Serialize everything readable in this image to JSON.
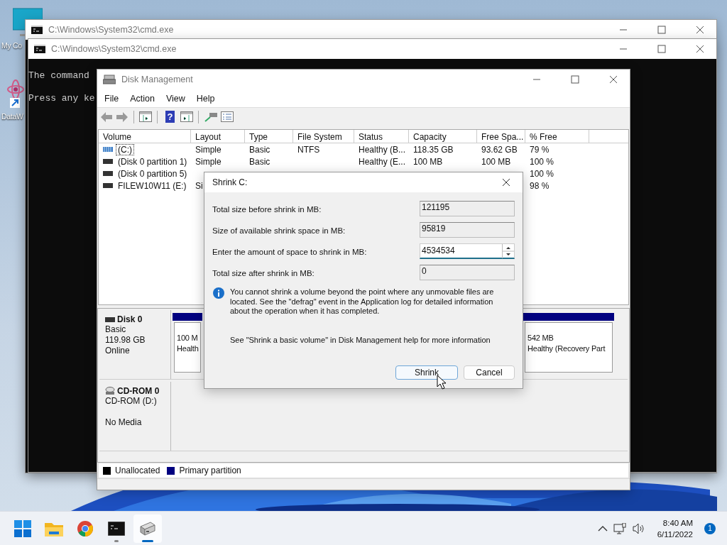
{
  "desktop_icons": [
    {
      "label": "My Co",
      "kind": "computer"
    },
    {
      "label": "DataW",
      "kind": "shortcut"
    }
  ],
  "console_windows": [
    {
      "title": "C:\\Windows\\System32\\cmd.exe"
    },
    {
      "title": "C:\\Windows\\System32\\cmd.exe",
      "lines": [
        "The command",
        "Press any ke"
      ]
    }
  ],
  "disk_management": {
    "title": "Disk Management",
    "menu": [
      "File",
      "Action",
      "View",
      "Help"
    ],
    "toolbar": [
      [
        {
          "kind": "back"
        },
        {
          "kind": "forward"
        }
      ],
      [
        {
          "kind": "console"
        }
      ],
      [
        {
          "kind": "help",
          "glyph": "?"
        },
        {
          "kind": "panel"
        }
      ],
      [
        {
          "kind": "connect"
        },
        {
          "kind": "list"
        }
      ]
    ],
    "columns": [
      "Volume",
      "Layout",
      "Type",
      "File System",
      "Status",
      "Capacity",
      "Free Spa...",
      "% Free"
    ],
    "rows": [
      {
        "selected": true,
        "cells": [
          "(C:)",
          "Simple",
          "Basic",
          "NTFS",
          "Healthy (B...",
          "118.35 GB",
          "93.62 GB",
          "79 %"
        ]
      },
      {
        "selected": false,
        "cells": [
          "(Disk 0 partition 1)",
          "Simple",
          "Basic",
          null,
          "Healthy (E...",
          "100 MB",
          "100 MB",
          "100 %"
        ]
      },
      {
        "selected": false,
        "cells": [
          "(Disk 0 partition 5)",
          null,
          null,
          null,
          null,
          null,
          null,
          "100 %"
        ]
      },
      {
        "selected": false,
        "cells": [
          "FILEW10W11 (E:)",
          "Si",
          null,
          null,
          null,
          null,
          null,
          "98 %"
        ]
      }
    ],
    "disks": [
      {
        "kind": "disk",
        "name": "Disk 0",
        "type": "Basic",
        "size": "119.98 GB",
        "status": "Online",
        "partitions": [
          {
            "lines": [
              "100 M",
              "Health"
            ]
          },
          {
            "lines": [
              "542 MB",
              "Healthy (Recovery Part"
            ]
          }
        ]
      },
      {
        "kind": "cdrom",
        "name": "CD-ROM 0",
        "type": "CD-ROM (D:)",
        "status": "No Media"
      }
    ],
    "legend": [
      {
        "label": "Unallocated",
        "color": "#000000"
      },
      {
        "label": "Primary partition",
        "color": "#000080"
      }
    ]
  },
  "dialog": {
    "title": "Shrink C:",
    "fields": [
      {
        "kind": "readonly",
        "label": "Total size before shrink in MB:",
        "value": "121195",
        "focused": false
      },
      {
        "kind": "readonly",
        "label": "Size of available shrink space in MB:",
        "value": "95819",
        "focused": false
      },
      {
        "kind": "spin",
        "label": "Enter the amount of space to shrink in MB:",
        "value": "4534534",
        "focused": true
      },
      {
        "kind": "readonly",
        "label": "Total size after shrink in MB:",
        "value": "0",
        "focused": false
      }
    ],
    "info": "You cannot shrink a volume beyond the point where any unmovable files are located. See the \"defrag\" event in the Application log for detailed information about the operation when it has completed.",
    "help": "See \"Shrink a basic volume\" in Disk Management help for more information",
    "buttons": [
      {
        "label": "Shrink",
        "default": true
      },
      {
        "label": "Cancel",
        "default": false
      }
    ]
  },
  "taskbar": {
    "apps": [
      {
        "kind": "start",
        "running": false,
        "active": false
      },
      {
        "kind": "explorer",
        "running": false,
        "active": false
      },
      {
        "kind": "browser",
        "running": false,
        "active": false
      },
      {
        "kind": "terminal",
        "running": true,
        "active": false
      },
      {
        "kind": "disk",
        "running": true,
        "active": true
      }
    ],
    "time": "8:40 AM",
    "date": "6/11/2022",
    "notifications": "1"
  }
}
